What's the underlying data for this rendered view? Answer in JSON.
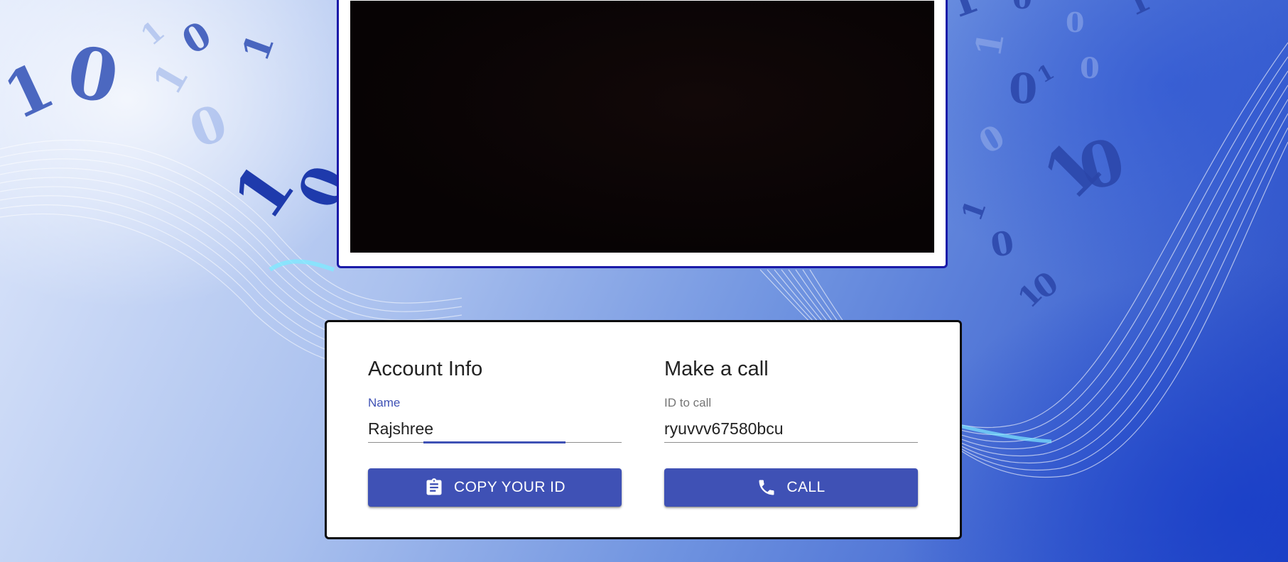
{
  "account_info": {
    "heading": "Account Info",
    "name_label": "Name",
    "name_value": "Rajshree",
    "copy_button_label": "COPY YOUR ID",
    "copy_button_icon": "clipboard-icon"
  },
  "make_call": {
    "heading": "Make a call",
    "id_label": "ID to call",
    "id_value": "ryuvvv67580bcu",
    "call_button_label": "CALL",
    "call_button_icon": "phone-icon"
  },
  "colors": {
    "primary": "#3f51b5",
    "video_border": "#1a1aa8",
    "panel_border": "#0c0c0c"
  }
}
